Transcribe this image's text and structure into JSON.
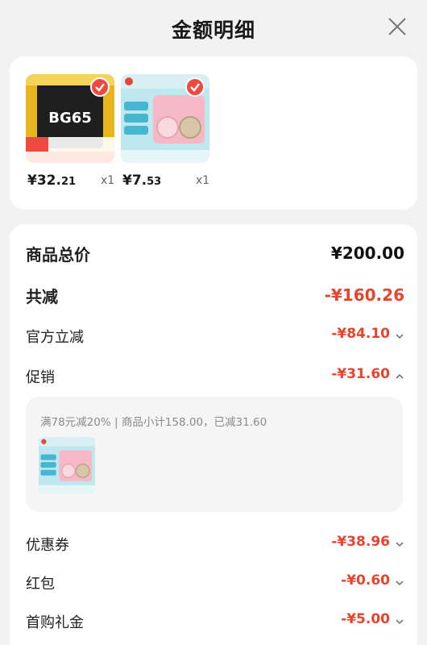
{
  "header": {
    "title": "金额明细"
  },
  "products": [
    {
      "price_main": "¥32.",
      "price_cents": "21",
      "qty": "x1",
      "thumb_text": "BG65"
    },
    {
      "price_main": "¥7.",
      "price_cents": "53",
      "qty": "x1"
    }
  ],
  "summary": {
    "total_label": "商品总价",
    "total_value": "¥200.00",
    "discount_label": "共减",
    "discount_value": "-¥160.26"
  },
  "lines": [
    {
      "label": "官方立减",
      "value": "-¥84.10"
    },
    {
      "label": "促销",
      "value": "-¥31.60"
    },
    {
      "label": "优惠券",
      "value": "-¥38.96"
    },
    {
      "label": "红包",
      "value": "-¥0.60"
    },
    {
      "label": "首购礼金",
      "value": "-¥5.00"
    }
  ],
  "promo": {
    "text": "满78元减20% | 商品小计158.00，已减31.60"
  },
  "colors": {
    "accent": "#e8432d",
    "check": "#f0493f"
  }
}
